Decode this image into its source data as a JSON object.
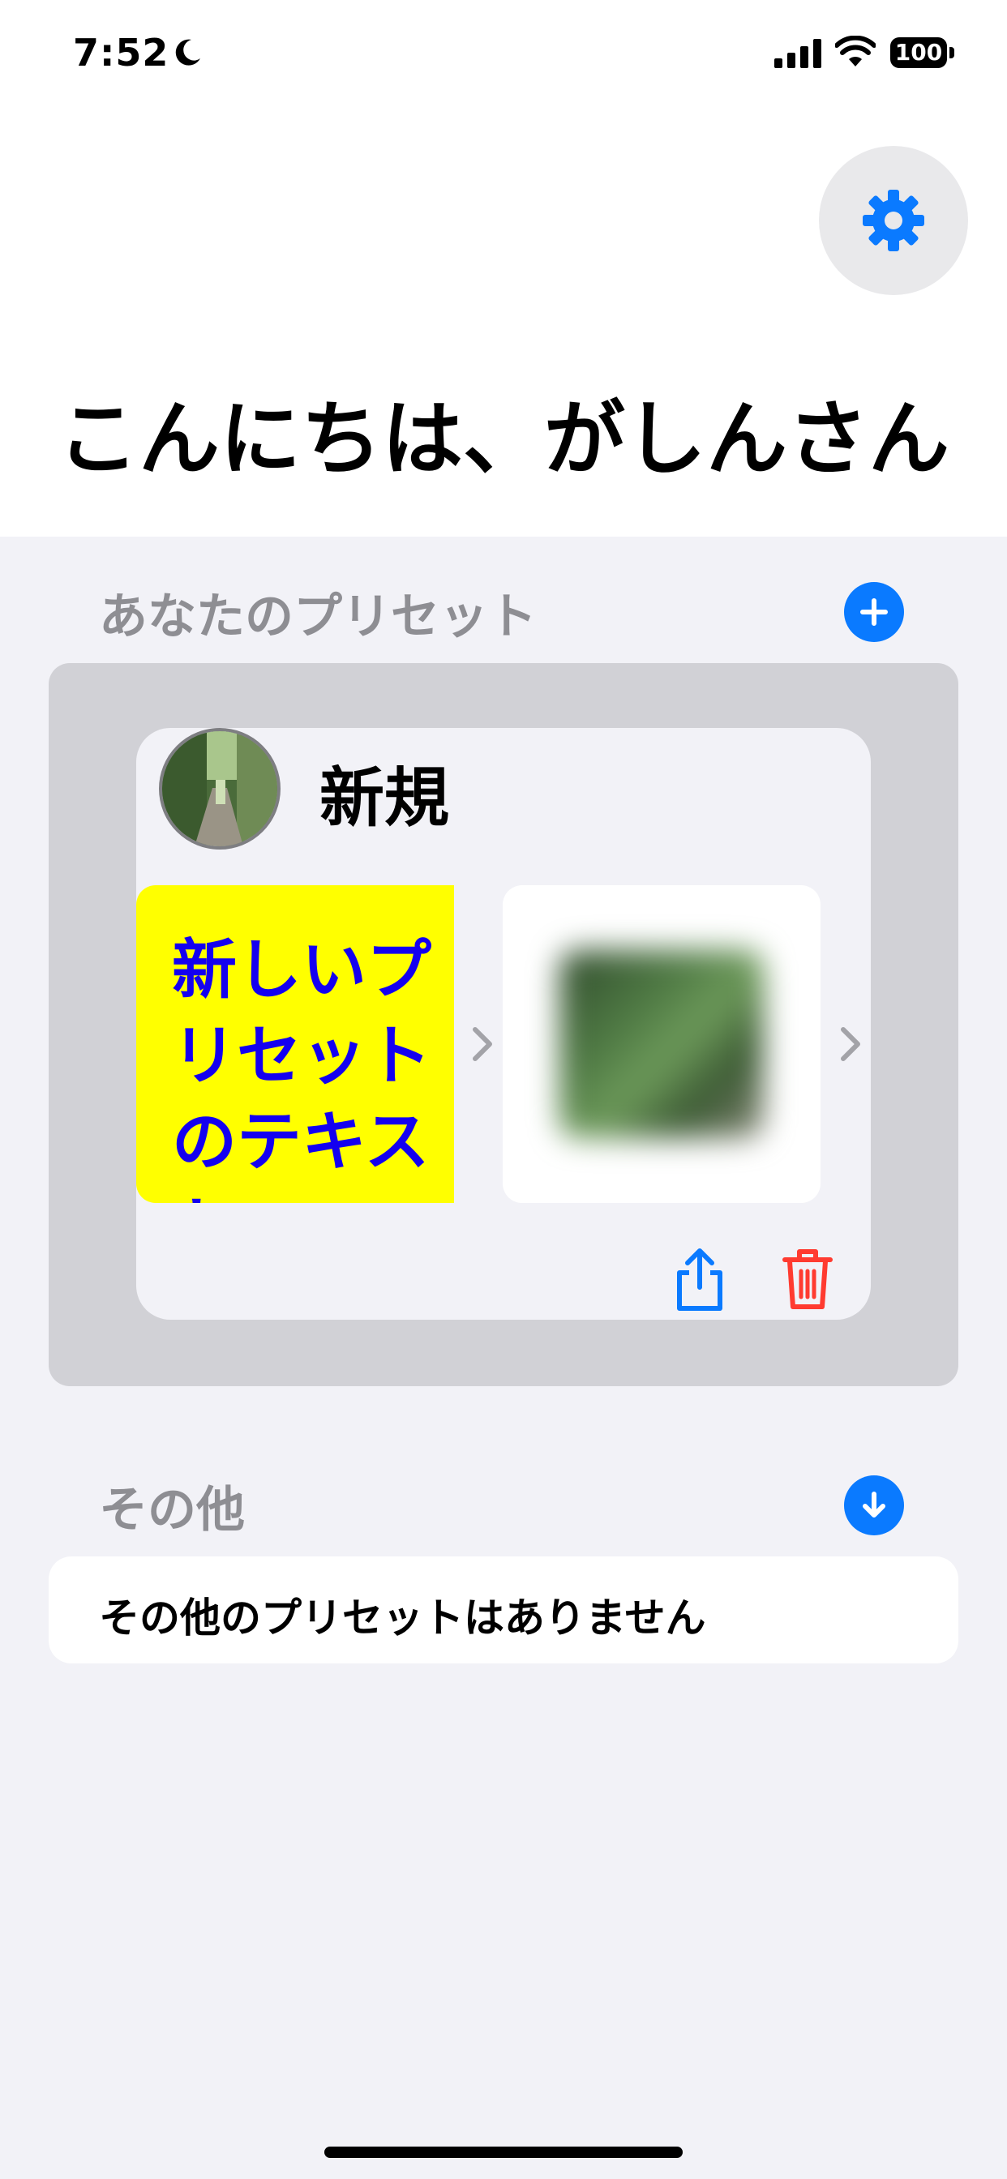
{
  "status_bar": {
    "time": "7:52",
    "battery": "100"
  },
  "greeting": "こんにちは、がしんさん",
  "presets_section": {
    "title": "あなたのプリセット",
    "add_icon": "plus-icon"
  },
  "preset_card": {
    "name": "新規",
    "text_tile": "新しいプリセットのテキスト",
    "text_tile_bg": "#FFFF00",
    "text_tile_color": "#1400F0",
    "share_icon": "share-icon",
    "delete_icon": "trash-icon"
  },
  "other_section": {
    "title": "その他",
    "download_icon": "arrow-down-icon",
    "empty_message": "その他のプリセットはありません"
  },
  "colors": {
    "accent": "#0A7AFF",
    "destructive": "#FF3B30",
    "background": "#F2F2F7",
    "section_header": "#8E8E93"
  }
}
